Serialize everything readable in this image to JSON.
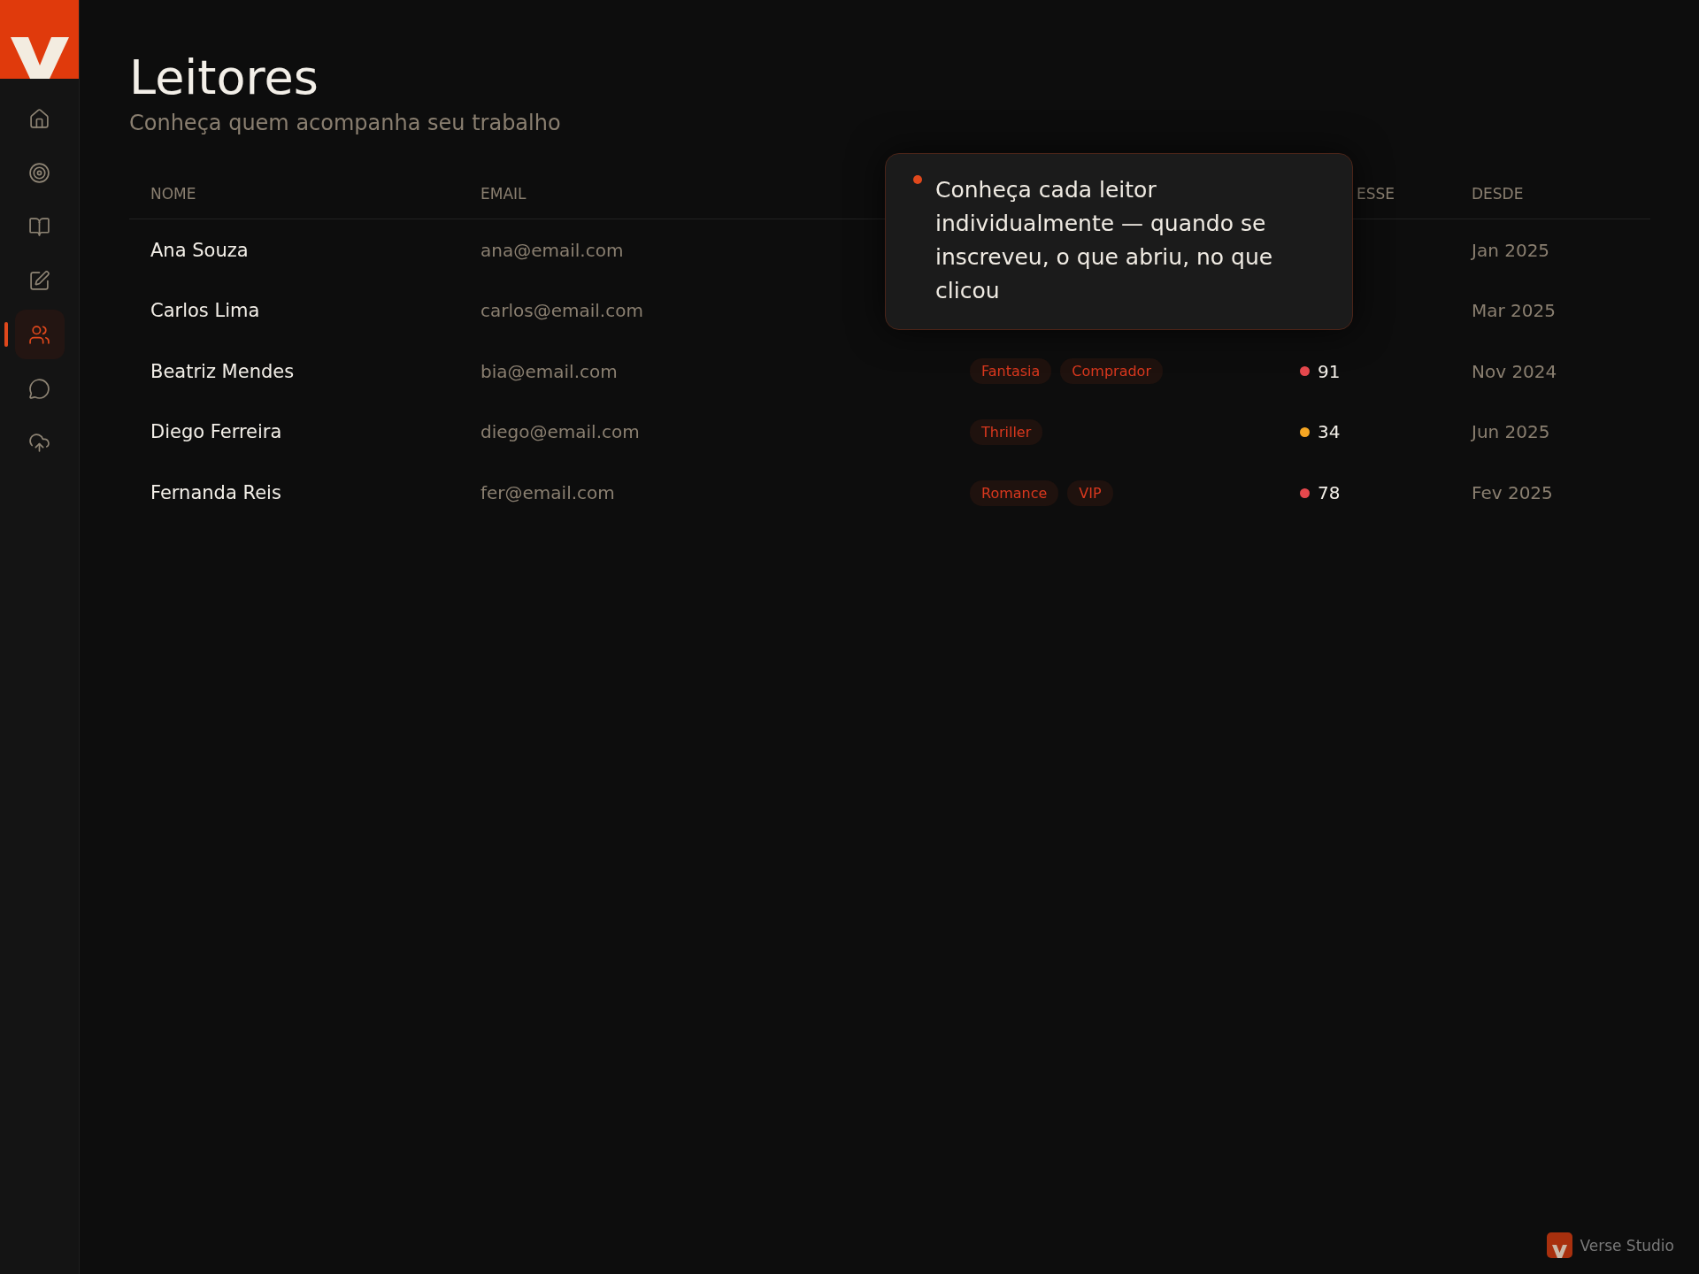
{
  "sidebar": {
    "items": [
      {
        "selected": false
      },
      {
        "selected": false
      },
      {
        "selected": false
      },
      {
        "selected": false
      },
      {
        "selected": true
      },
      {
        "selected": false
      },
      {
        "selected": false
      }
    ]
  },
  "header": {
    "title": "Leitores",
    "subtitle": "Conheça quem acompanha seu trabalho"
  },
  "table": {
    "columns": [
      {
        "label": "NOME"
      },
      {
        "label": "EMAIL"
      },
      {
        "label": "ESSE"
      },
      {
        "label": "DESDE"
      }
    ],
    "rows": [
      {
        "name": "Ana Souza",
        "email": "ana@email.com",
        "since": "Jan 2025"
      },
      {
        "name": "Carlos Lima",
        "email": "carlos@email.com",
        "since": "Mar 2025"
      },
      {
        "name": "Beatriz Mendes",
        "email": "bia@email.com",
        "tags": [
          "Fantasia",
          "Comprador"
        ],
        "score": {
          "text": "91",
          "color": "#e5484d"
        },
        "since": "Nov 2024"
      },
      {
        "name": "Diego Ferreira",
        "email": "diego@email.com",
        "tags": [
          "Thriller"
        ],
        "score": {
          "text": "34",
          "color": "#f5a623"
        },
        "since": "Jun 2025"
      },
      {
        "name": "Fernanda Reis",
        "email": "fer@email.com",
        "tags": [
          "Romance",
          "VIP"
        ],
        "score": {
          "text": "78",
          "color": "#e5484d"
        },
        "since": "Fev 2025"
      }
    ]
  },
  "tooltip": {
    "text": "Conheça cada leitor individualmente — quando se inscreveu, o que abriu, no que clicou"
  },
  "badge": {
    "label": "Verse Studio"
  }
}
